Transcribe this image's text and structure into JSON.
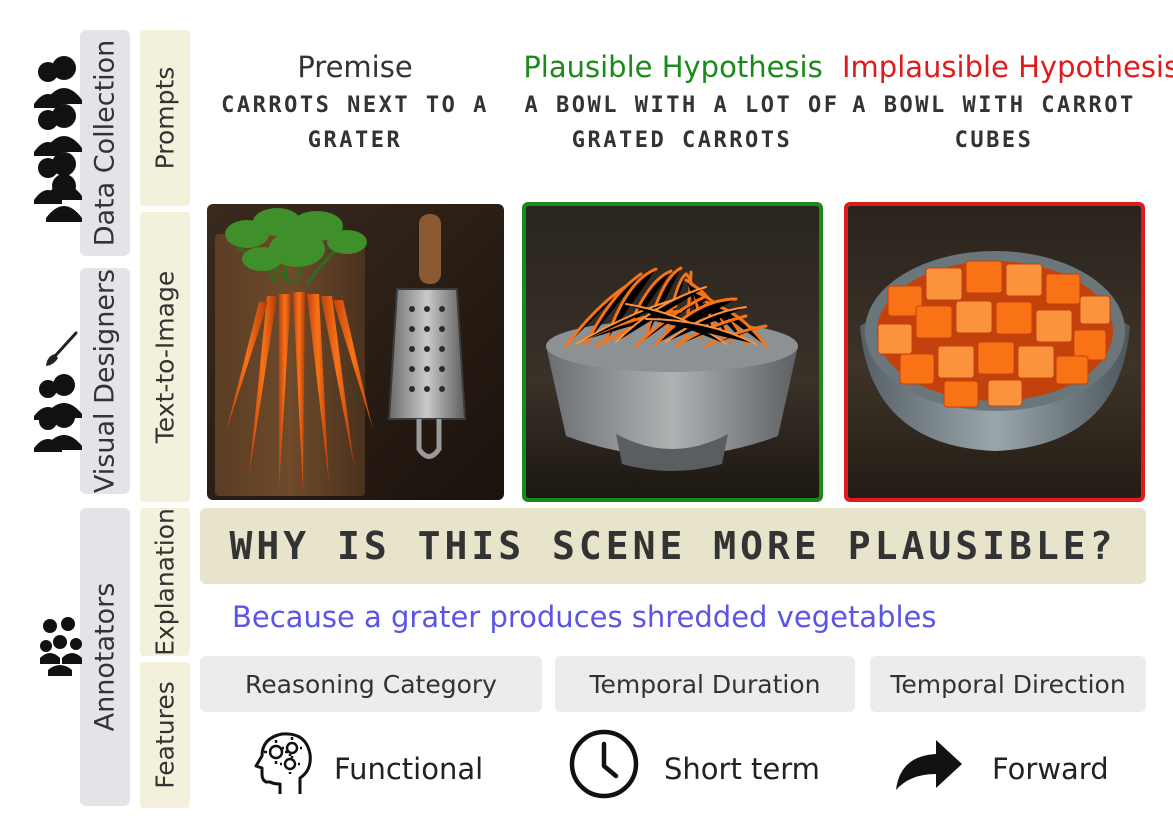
{
  "groups": {
    "data_collection": "Data Collection",
    "visual_designers": "Visual Designers",
    "annotators": "Annotators"
  },
  "stages": {
    "prompts": "Prompts",
    "text_to_image": "Text-to-Image",
    "explanation": "Explanation",
    "features": "Features"
  },
  "columns": [
    {
      "heading": "Premise",
      "caption_line1": "CARROTS NEXT TO A",
      "caption_line2": "GRATER",
      "heading_color": "#333333",
      "border_color": "none"
    },
    {
      "heading": "Plausible Hypothesis",
      "caption_line1": "A BOWL WITH A LOT OF",
      "caption_line2": "GRATED CARROTS",
      "heading_color": "#1a8a1a",
      "border_color": "#1a8a1a"
    },
    {
      "heading": "Implausible Hypothesis",
      "caption_line1": "A BOWL WITH CARROT",
      "caption_line2": "CUBES",
      "heading_color": "#e01b1b",
      "border_color": "#e01b1b"
    }
  ],
  "question": "WHY IS THIS SCENE MORE PLAUSIBLE?",
  "explanation": "Because a grater produces shredded vegetables",
  "features": [
    {
      "category": "Reasoning Category",
      "value": "Functional",
      "icon": "head-gears-icon"
    },
    {
      "category": "Temporal Duration",
      "value": "Short term",
      "icon": "clock-icon"
    },
    {
      "category": "Temporal Direction",
      "value": "Forward",
      "icon": "forward-arrow-icon"
    }
  ],
  "colors": {
    "plausible": "#1a8a1a",
    "implausible": "#e01b1b",
    "explanation_text": "#5a55e6",
    "question_bar": "#e8e3cb",
    "group_bar": "#e3e4e8",
    "stage_bar": "#f3f0dc"
  }
}
